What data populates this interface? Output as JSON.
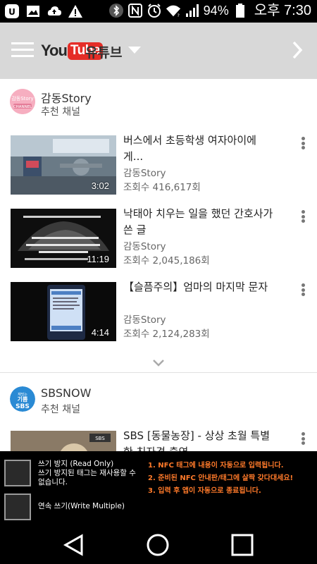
{
  "status_bar": {
    "battery": "94%",
    "time": "오후 7:30"
  },
  "header": {
    "logo": "YouTube",
    "logo_you": "You",
    "logo_tube": "Tube",
    "title": "유튜브"
  },
  "sections": [
    {
      "channel": "감동Story",
      "subtitle": "추천 채널",
      "videos": [
        {
          "title": "버스에서 초등학생 여자아이에게...",
          "channel": "감동Story",
          "views": "조회수 416,617회",
          "duration": "3:02"
        },
        {
          "title": "낙태아 치우는 일을 했던 간호사가 쓴 글",
          "channel": "감동Story",
          "views": "조회수 2,045,186회",
          "duration": "11:19"
        },
        {
          "title": "【슬픔주의】엄마의 마지막 문자",
          "channel": "감동Story",
          "views": "조회수 2,124,283회",
          "duration": "4:14"
        }
      ]
    },
    {
      "channel": "SBSNOW",
      "subtitle": "추천 채널",
      "videos": [
        {
          "title": "SBS [동물농장] - 상상 초월 특별한 친자견 출연",
          "channel": "",
          "views": "",
          "duration": ""
        }
      ]
    }
  ],
  "nfc": {
    "read_only_label": "쓰기 방지 (Read Only)",
    "read_only_desc": "쓰기 방지된 태그는 재사용할 수 없습니다.",
    "write_multiple_label": "연속 쓰기(Write Multiple)",
    "guide": [
      "1. NFC 태그에 내용이 자동으로 입력됩니다.",
      "2. 준비된 NFC 안내판/태그에 살짝 갖다대세요!",
      "3. 입력 후 앱이 자동으로 종료됩니다."
    ]
  },
  "colors": {
    "header_bg": "#d8d8d8",
    "youtube_red": "#e52d27",
    "nfc_guide": "#ff7a2a"
  }
}
